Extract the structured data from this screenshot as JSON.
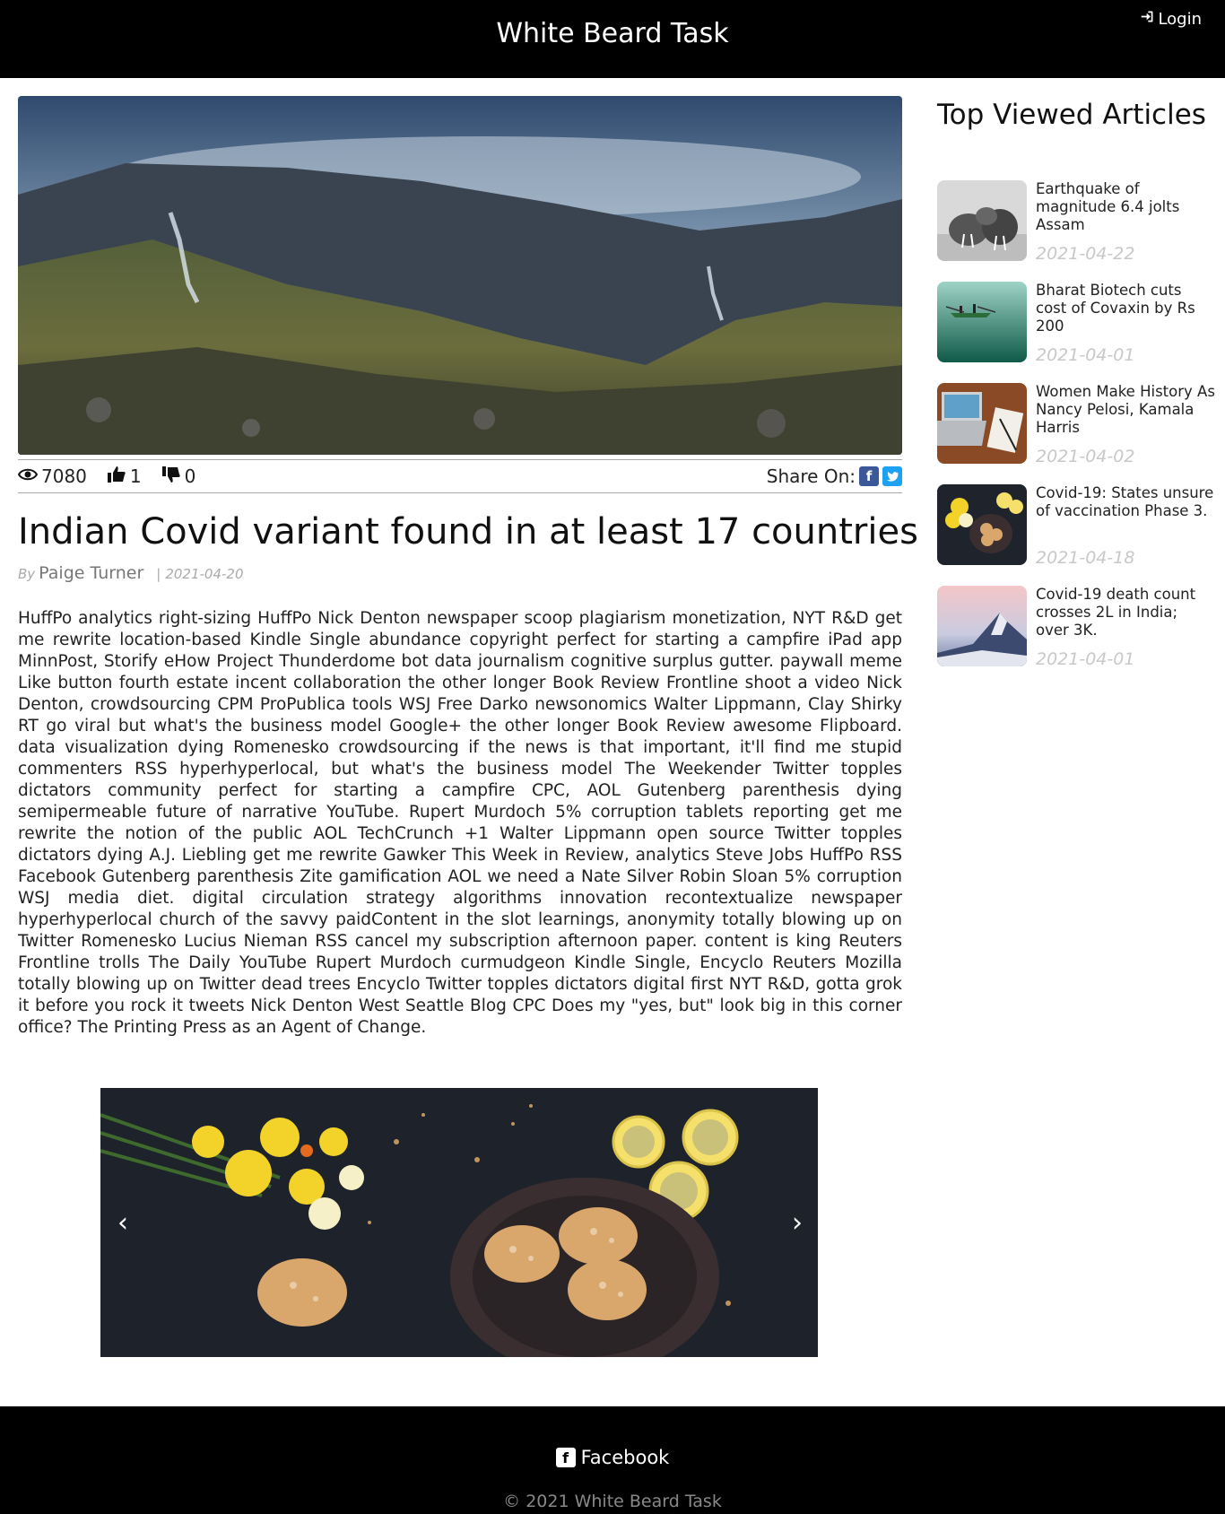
{
  "header": {
    "site_title": "White Beard Task",
    "login_label": "Login"
  },
  "article": {
    "views": "7080",
    "likes": "1",
    "dislikes": "0",
    "share_label": "Share On:",
    "title": "Indian Covid variant found in at least 17 countries",
    "by_prefix": "By",
    "author": "Paige Turner",
    "date": "2021-04-20",
    "body": "HuffPo analytics right-sizing HuffPo Nick Denton newspaper scoop plagiarism monetization, NYT R&D get me rewrite location-based Kindle Single abundance copyright perfect for starting a campfire iPad app MinnPost, Storify eHow Project Thunderdome bot data journalism cognitive surplus gutter. paywall meme Like button fourth estate incent collaboration the other longer Book Review Frontline shoot a video Nick Denton, crowdsourcing CPM ProPublica tools WSJ Free Darko newsonomics Walter Lippmann, Clay Shirky RT go viral but what's the business model Google+ the other longer Book Review awesome Flipboard. data visualization dying Romenesko crowdsourcing if the news is that important, it'll find me stupid commenters RSS hyperhyperlocal, but what's the business model The Weekender Twitter topples dictators community perfect for starting a campfire CPC, AOL Gutenberg parenthesis dying semipermeable future of narrative YouTube. Rupert Murdoch 5% corruption tablets reporting get me rewrite the notion of the public AOL TechCrunch +1 Walter Lippmann open source Twitter topples dictators dying A.J. Liebling get me rewrite Gawker This Week in Review, analytics Steve Jobs HuffPo RSS Facebook Gutenberg parenthesis Zite gamification AOL we need a Nate Silver Robin Sloan 5% corruption WSJ media diet. digital circulation strategy algorithms innovation recontextualize newspaper hyperhyperlocal church of the savvy paidContent in the slot learnings, anonymity totally blowing up on Twitter Romenesko Lucius Nieman RSS cancel my subscription afternoon paper. content is king Reuters Frontline trolls The Daily YouTube Rupert Murdoch curmudgeon Kindle Single, Encyclo Reuters Mozilla totally blowing up on Twitter dead trees Encyclo Twitter topples dictators digital first NYT R&D, gotta grok it before you rock it tweets Nick Denton West Seattle Blog CPC Does my \"yes, but\" look big in this corner office? The Printing Press as an Agent of Change."
  },
  "carousel": {
    "prev_glyph": "‹",
    "next_glyph": "›"
  },
  "sidebar": {
    "title": "Top Viewed Articles",
    "items": [
      {
        "headline": "Earthquake of magnitude 6.4 jolts Assam",
        "date": "2021-04-22",
        "thumb": "walrus-photo"
      },
      {
        "headline": "Bharat Biotech cuts cost of Covaxin by Rs 200",
        "date": "2021-04-01",
        "thumb": "boat-on-green-water-photo"
      },
      {
        "headline": "Women Make History As Nancy Pelosi, Kamala Harris",
        "date": "2021-04-02",
        "thumb": "laptop-desk-photo"
      },
      {
        "headline": "Covid-19: States unsure of vaccination Phase 3.",
        "date": "2021-04-18",
        "thumb": "flowers-cookies-photo"
      },
      {
        "headline": "Covid-19 death count crosses 2L in India; over 3K.",
        "date": "2021-04-01",
        "thumb": "mountain-peak-photo"
      }
    ]
  },
  "footer": {
    "facebook_label": "Facebook",
    "copyright": "© 2021 White Beard Task"
  },
  "colors": {
    "header_bg": "#000000",
    "facebook_blue": "#3b5998",
    "twitter_blue": "#1da1f2",
    "date_gray": "#c8c8c8"
  }
}
